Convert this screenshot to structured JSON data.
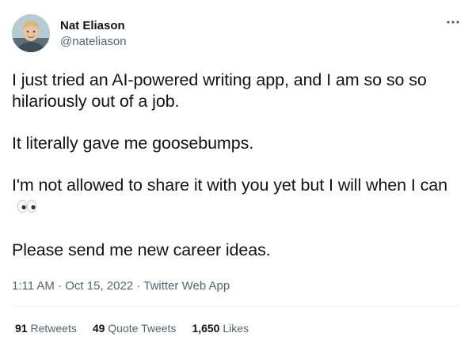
{
  "author": {
    "name": "Nat Eliason",
    "handle": "@nateliason"
  },
  "tweet": {
    "paragraphs": [
      "I just tried an AI-powered writing app, and I am so so so hilariously out of a job.",
      "It literally gave me goosebumps.",
      "I'm not allowed to share it with you yet but I will when I can",
      "Please send me new career ideas."
    ],
    "emoji_icon": "eyes-emoji"
  },
  "meta": {
    "time": "1:11 AM",
    "separator": "·",
    "date": "Oct 15, 2022",
    "source": "Twitter Web App"
  },
  "stats": {
    "retweets_count": "91",
    "retweets_label": "Retweets",
    "quotes_count": "49",
    "quotes_label": "Quote Tweets",
    "likes_count": "1,650",
    "likes_label": "Likes"
  },
  "colors": {
    "text_primary": "#0f1419",
    "text_secondary": "#536471",
    "divider": "#eff3f4"
  }
}
